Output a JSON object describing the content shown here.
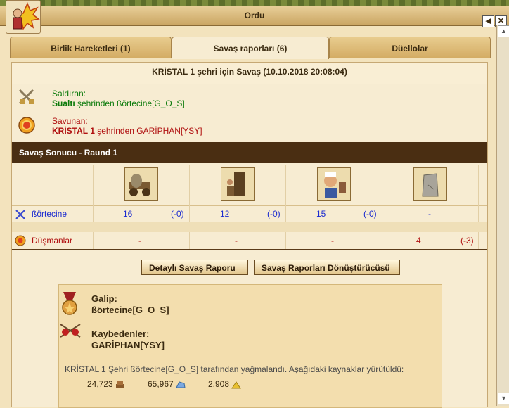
{
  "window": {
    "title": "Ordu"
  },
  "tabs": [
    {
      "label": "Birlik Hareketleri (1)"
    },
    {
      "label": "Savaş raporları (6)"
    },
    {
      "label": "Düellolar"
    }
  ],
  "report": {
    "title": "KRİSTAL 1 şehri için Savaş (10.10.2018 20:08:04)",
    "attacker": {
      "heading": "Saldıran:",
      "city": "Sualtı",
      "text": " şehrinden ßörtecine[G_O_S]"
    },
    "defender": {
      "heading": "Savunan:",
      "city": "KRİSTAL 1",
      "text": " şehrinden GARİPHAN[YSY]"
    },
    "section_title": "Savaş Sonucu - Raund 1",
    "rows": [
      {
        "name": "ßörtecine",
        "cells": [
          [
            "16",
            "(-0)"
          ],
          [
            "12",
            "(-0)"
          ],
          [
            "15",
            "(-0)"
          ],
          [
            "-",
            ""
          ]
        ]
      },
      {
        "name": "Düşmanlar",
        "cells": [
          [
            "-",
            ""
          ],
          [
            "-",
            ""
          ],
          [
            "-",
            ""
          ],
          [
            "4",
            "(-3)"
          ]
        ]
      }
    ],
    "buttons": {
      "detail": "Detaylı Savaş Raporu",
      "converter": "Savaş Raporları Dönüştürücüsü"
    },
    "winner": {
      "heading": "Galip:",
      "name": "ßörtecine[G_O_S]"
    },
    "losers": {
      "heading": "Kaybedenler:",
      "name": "GARİPHAN[YSY]"
    },
    "loot_text": "KRİSTAL 1 Şehri ßörtecine[G_O_S] tarafından yağmalandı. Aşağıdaki kaynaklar yürütüldü:",
    "loot": [
      {
        "value": "24,723",
        "icon": "wood-icon"
      },
      {
        "value": "65,967",
        "icon": "marble-icon"
      },
      {
        "value": "2,908",
        "icon": "sulphur-icon"
      }
    ]
  }
}
